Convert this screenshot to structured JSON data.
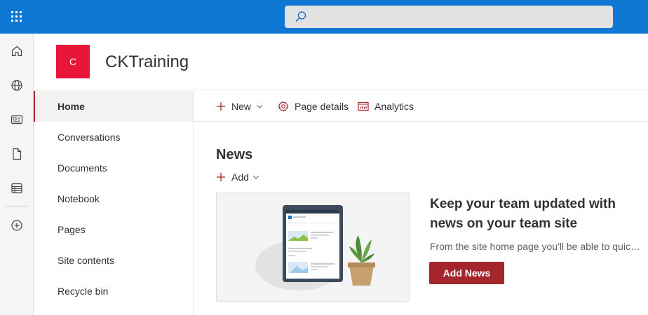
{
  "suitebar": {
    "app_launcher_icon": "waffle-icon",
    "search_icon": "search-icon",
    "search_value": "",
    "brand_color": "#0f78d4"
  },
  "appbar": {
    "items": [
      {
        "icon": "home-icon"
      },
      {
        "icon": "globe-icon"
      },
      {
        "icon": "news-icon"
      },
      {
        "icon": "document-icon"
      },
      {
        "icon": "lists-icon"
      },
      {
        "icon": "add-circle-icon"
      }
    ]
  },
  "site": {
    "logo_letter": "C",
    "logo_color": "#e8173a",
    "title": "CKTraining"
  },
  "nav": {
    "items": [
      {
        "label": "Home",
        "selected": true
      },
      {
        "label": "Conversations"
      },
      {
        "label": "Documents"
      },
      {
        "label": "Notebook"
      },
      {
        "label": "Pages"
      },
      {
        "label": "Site contents"
      },
      {
        "label": "Recycle bin"
      }
    ]
  },
  "commandbar": {
    "new_label": "New",
    "page_details_label": "Page details",
    "analytics_label": "Analytics",
    "accent": "#a4262c"
  },
  "news": {
    "title": "News",
    "add_label": "Add",
    "heading": "Keep your team updated with news on your team site",
    "description": "From the site home page you'll be able to quickly author a news post",
    "add_news_button": "Add News"
  }
}
